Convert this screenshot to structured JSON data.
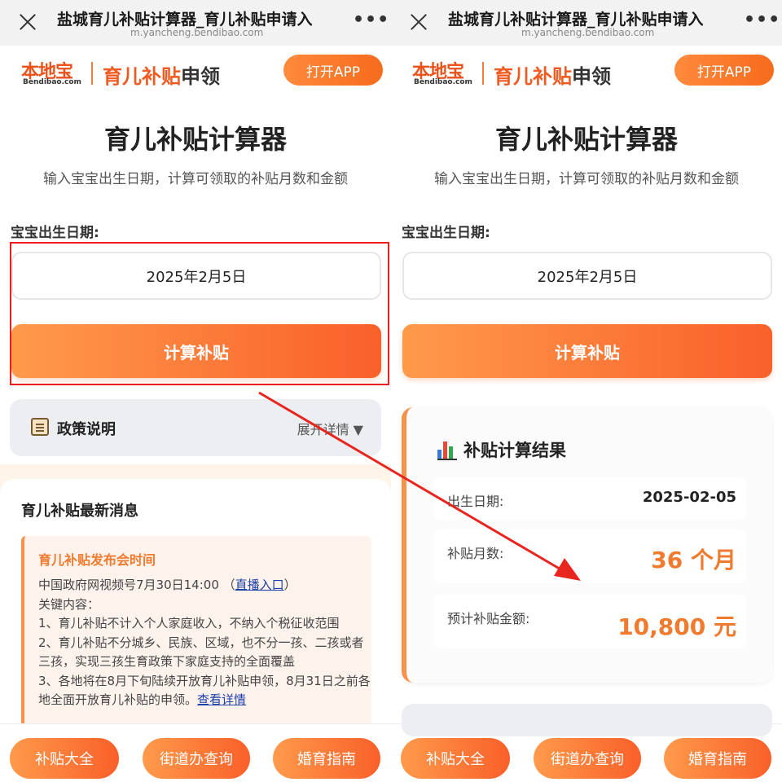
{
  "topbar": {
    "title": "盐城育儿补贴计算器_育儿补贴申请入",
    "url": "m.yancheng.bendibao.com",
    "more": "•••"
  },
  "header": {
    "logo_main": "本地宝",
    "logo_sub": "Bendibao.com",
    "brand_accent": "育儿补贴",
    "brand_rest": "申领",
    "open_app": "打开APP"
  },
  "page": {
    "title": "育儿补贴计算器",
    "subtitle": "输入宝宝出生日期，计算可领取的补贴月数和金额"
  },
  "form": {
    "date_label": "宝宝出生日期:",
    "date_value": "2025年2月5日",
    "calc_button": "计算补贴"
  },
  "policy": {
    "title": "政策说明",
    "expand": "展开详情 ▼"
  },
  "news": {
    "title": "育儿补贴最新消息",
    "head": "育儿补贴发布会时间",
    "line1_pre": "中国政府网视频号7月30日14:00 （",
    "line1_link": "直播入口",
    "line1_post": "）",
    "line2": "关键内容：",
    "line3": "1、育儿补贴不计入个人家庭收入，不纳入个税征收范围",
    "line4": "2、育儿补贴不分城乡、民族、区域，也不分一孩、二孩或者三孩，实现三孩生育政策下家庭支持的全面覆盖",
    "line5": "3、各地将在8月下旬陆续开放育儿补贴申领，8月31日之前各地全面开放育儿补贴的申领。",
    "line5_link": "查看详情"
  },
  "bottom_nav": [
    "补贴大全",
    "街道办查询",
    "婚育指南"
  ],
  "result": {
    "title": "补贴计算结果",
    "birth_label": "出生日期:",
    "birth_value": "2025-02-05",
    "months_label": "补贴月数:",
    "months_value": "36 个月",
    "amount_label": "预计补贴金额:",
    "amount_value": "10,800 元"
  },
  "colors": {
    "accent": "#f76b1c",
    "highlight_box": "#ee1c1c",
    "arrow": "#e8261f",
    "link": "#1b3fa8"
  }
}
